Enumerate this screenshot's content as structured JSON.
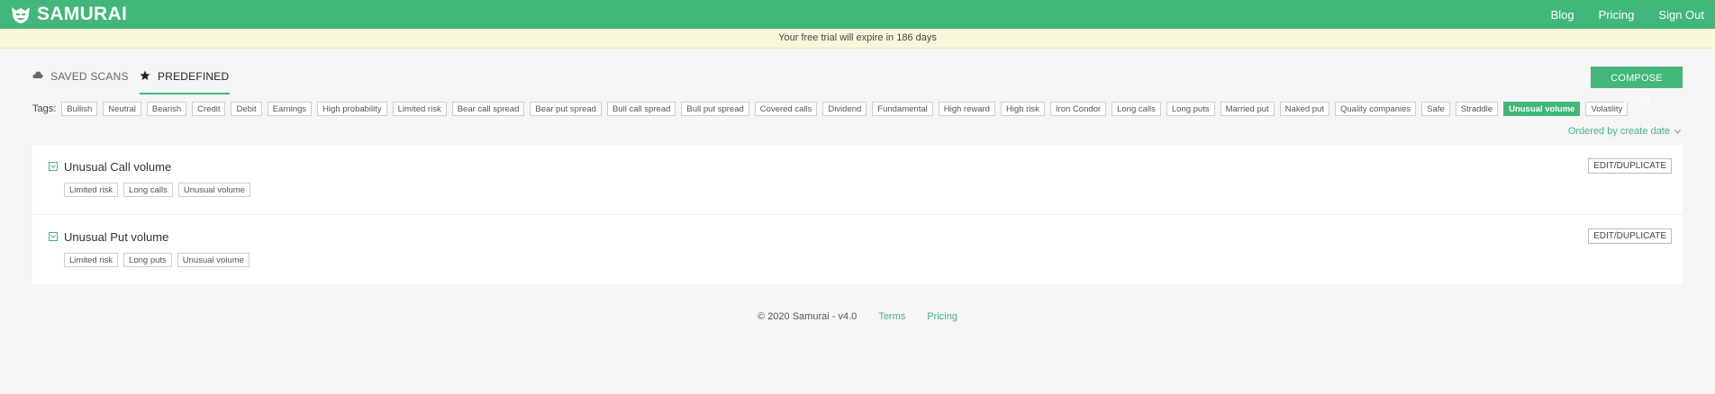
{
  "header": {
    "logo_text": "SAMURAI",
    "nav": [
      "Blog",
      "Pricing",
      "Sign Out"
    ]
  },
  "trial_banner": "Your free trial will expire in 186 days",
  "tabs": {
    "saved": "SAVED SCANS",
    "predefined": "PREDEFINED",
    "active": "predefined"
  },
  "compose_label": "COMPOSE SCAN",
  "tags_label": "Tags:",
  "tags": [
    "Bullish",
    "Neutral",
    "Bearish",
    "Credit",
    "Debit",
    "Earnings",
    "High probability",
    "Limited risk",
    "Bear call spread",
    "Bear put spread",
    "Bull call spread",
    "Bull put spread",
    "Covered calls",
    "Dividend",
    "Fundamental",
    "High reward",
    "High risk",
    "Iron Condor",
    "Long calls",
    "Long puts",
    "Married put",
    "Naked put",
    "Quality companies",
    "Safe",
    "Straddle",
    "Unusual volume",
    "Volatility"
  ],
  "active_tag": "Unusual volume",
  "order_label": "Ordered by create date",
  "scans": [
    {
      "title": "Unusual Call volume",
      "tags": [
        "Limited risk",
        "Long calls",
        "Unusual volume"
      ],
      "action": "EDIT/DUPLICATE"
    },
    {
      "title": "Unusual Put volume",
      "tags": [
        "Limited risk",
        "Long puts",
        "Unusual volume"
      ],
      "action": "EDIT/DUPLICATE"
    }
  ],
  "footer": {
    "copyright": "© 2020 Samurai - v4.0",
    "links": [
      "Terms",
      "Pricing"
    ]
  },
  "colors": {
    "brand": "#41b779",
    "banner": "#f9f8dc"
  },
  "icons": {
    "logo": "samurai-mask-icon",
    "saved": "cloud-icon",
    "predefined": "star-icon",
    "expand": "chevron-down-icon"
  }
}
